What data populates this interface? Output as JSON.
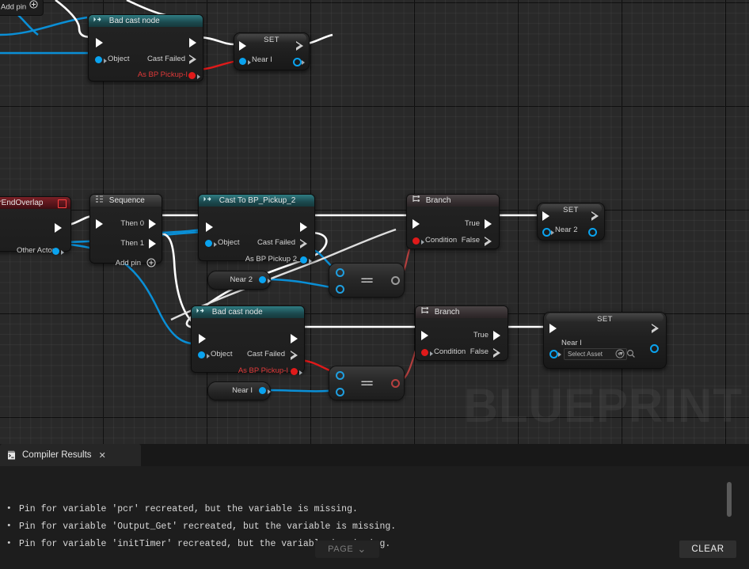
{
  "graph": {
    "watermark": "BLUEPRINT",
    "add_pin_top": {
      "label": "Add pin",
      "icon": "plus-circle-icon"
    },
    "nodes": [
      {
        "id": "bad-cast-top",
        "title": "Bad cast node",
        "inputs": [
          "Object"
        ],
        "outputs": [
          "Cast Failed",
          "As BP Pickup-I"
        ]
      },
      {
        "id": "set-near-i-top",
        "title": "SET",
        "pin_label": "Near I"
      },
      {
        "id": "event-end-overlap",
        "title": "ctorEndOverlap",
        "outputs": [
          "Other Actor"
        ]
      },
      {
        "id": "sequence",
        "title": "Sequence",
        "outputs": [
          "Then 0",
          "Then 1"
        ],
        "add_pin": "Add pin"
      },
      {
        "id": "cast-to-bp-pickup-2",
        "title": "Cast To BP_Pickup_2",
        "inputs": [
          "Object"
        ],
        "outputs": [
          "Cast Failed",
          "As BP Pickup 2"
        ]
      },
      {
        "id": "branch-top",
        "title": "Branch",
        "inputs": [
          "Condition"
        ],
        "outputs": [
          "True",
          "False"
        ]
      },
      {
        "id": "set-near-2",
        "title": "SET",
        "pin_label": "Near 2"
      },
      {
        "id": "getter-near-2",
        "title": "Near 2"
      },
      {
        "id": "equals-top",
        "symbol": "=="
      },
      {
        "id": "bad-cast-bottom",
        "title": "Bad cast node",
        "inputs": [
          "Object"
        ],
        "outputs": [
          "Cast Failed",
          "As BP Pickup-I"
        ]
      },
      {
        "id": "branch-bottom",
        "title": "Branch",
        "inputs": [
          "Condition"
        ],
        "outputs": [
          "True",
          "False"
        ]
      },
      {
        "id": "set-near-i-bottom",
        "title": "SET",
        "pin_label": "Near I",
        "asset_picker": {
          "value": "Select Asset",
          "browse_icon": "browse-icon",
          "search_icon": "search-icon"
        }
      },
      {
        "id": "getter-near-i",
        "title": "Near I"
      },
      {
        "id": "equals-bottom",
        "symbol": "=="
      }
    ]
  },
  "panel": {
    "tab": {
      "label": "Compiler Results",
      "icon": "compiler-log-icon",
      "close": "✕"
    },
    "messages": [
      "Pin for variable 'pcr' recreated, but the variable is missing.",
      "Pin for variable 'Output_Get' recreated, but the variable is missing.",
      "Pin for variable 'initTimer' recreated, but the variable is missing."
    ],
    "page_button": {
      "label": "PAGE",
      "chevron": "⌄"
    },
    "clear_button": "CLEAR"
  },
  "colors": {
    "exec_wire": "#ffffff",
    "data_wire_blue": "#0a8fd6",
    "error_red": "#e01a1a",
    "cast_header": "#2f7d83"
  }
}
